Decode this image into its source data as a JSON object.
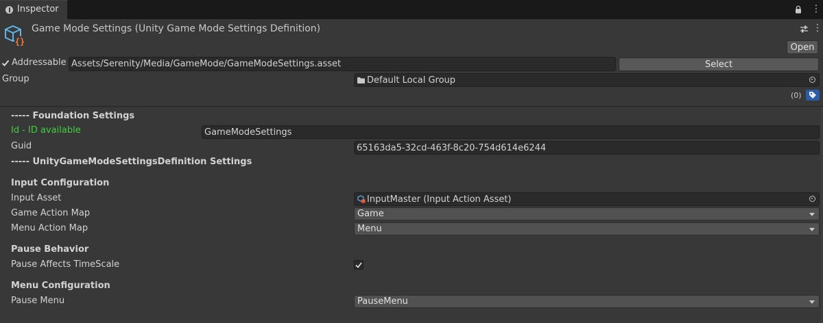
{
  "tab": {
    "label": "Inspector",
    "icon": "info-icon"
  },
  "window_controls": {
    "lock_icon": "lock-icon",
    "menu_glyph": "⋮"
  },
  "header": {
    "title": "Game Mode Settings (Unity Game Mode Settings Definition)",
    "asset_icon": "scriptable-object-icon",
    "settings_icon": "sliders-icon",
    "menu_glyph": "⋮",
    "open_label": "Open"
  },
  "addressable": {
    "checked": true,
    "label": "Addressable",
    "path": "Assets/Serenity/Media/GameMode/GameModeSettings.asset",
    "select_label": "Select",
    "group_label": "Group",
    "group_value": "Default Local Group",
    "labels_count": "(0)"
  },
  "foundation": {
    "header": "----- Foundation Settings",
    "id_label": "Id - ID available",
    "id_value": "GameModeSettings",
    "guid_label": "Guid",
    "guid_value": "65163da5-32cd-463f-8c20-754d614e6244"
  },
  "definition_header": "----- UnityGameModeSettingsDefinition Settings",
  "input": {
    "header": "Input Configuration",
    "asset_label": "Input Asset",
    "asset_value": "InputMaster (Input Action Asset)",
    "game_map_label": "Game Action Map",
    "game_map_value": "Game",
    "menu_map_label": "Menu Action Map",
    "menu_map_value": "Menu"
  },
  "pause": {
    "header": "Pause Behavior",
    "timescale_label": "Pause Affects TimeScale",
    "timescale_checked": true
  },
  "menu": {
    "header": "Menu Configuration",
    "pause_menu_label": "Pause Menu",
    "pause_menu_value": "PauseMenu"
  },
  "colors": {
    "background": "#383838",
    "tabbar": "#191919",
    "field": "#2a2a2a",
    "id_available": "#3fd03f",
    "tag_blue": "#2b5ca8"
  }
}
